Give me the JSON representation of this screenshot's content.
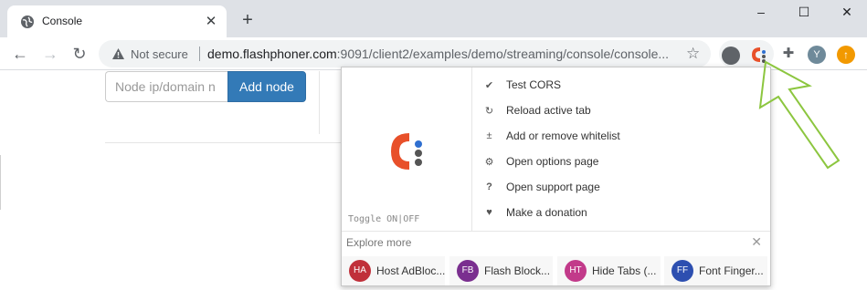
{
  "tab": {
    "title": "Console"
  },
  "toolbar": {
    "security_label": "Not secure",
    "url_host": "demo.flashphoner.com",
    "url_rest": ":9091/client2/examples/demo/streaming/console/console..."
  },
  "profile": {
    "initial": "Y"
  },
  "page": {
    "node_placeholder": "Node ip/domain n",
    "add_node_label": "Add node"
  },
  "popup": {
    "toggle_label": "Toggle ON|OFF",
    "menu": [
      {
        "label": "Test CORS",
        "icon": "check-icon"
      },
      {
        "label": "Reload active tab",
        "icon": "reload-icon"
      },
      {
        "label": "Add or remove whitelist",
        "icon": "plus-minus-icon"
      },
      {
        "label": "Open options page",
        "icon": "gear-icon"
      },
      {
        "label": "Open support page",
        "icon": "question-icon"
      },
      {
        "label": "Make a donation",
        "icon": "heart-icon"
      }
    ],
    "explore_title": "Explore more",
    "recommendations": [
      {
        "badge": "HA",
        "label": "Host AdBloc...",
        "color": "#c0303a"
      },
      {
        "badge": "FB",
        "label": "Flash Block...",
        "color": "#7a2f8f"
      },
      {
        "badge": "HT",
        "label": "Hide Tabs (...",
        "color": "#c23a8a"
      },
      {
        "badge": "FF",
        "label": "Font Finger...",
        "color": "#2d4fb0"
      }
    ]
  },
  "colors": {
    "accent": "#337ab7",
    "logo_red": "#e8502a",
    "arrow": "#8cc63f"
  }
}
